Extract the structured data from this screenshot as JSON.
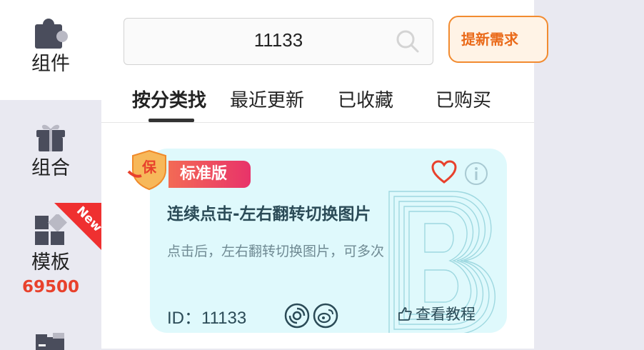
{
  "sidebar": {
    "items": [
      {
        "label": "组件",
        "icon": "puzzle-icon"
      },
      {
        "label": "组合",
        "icon": "gift-icon"
      },
      {
        "label": "模板",
        "icon": "template-icon",
        "count": "69500",
        "ribbon": "New"
      }
    ]
  },
  "search": {
    "value": "11133",
    "icon": "search-icon"
  },
  "header": {
    "demand_button": "提新需求"
  },
  "tabs": [
    {
      "label": "按分类找",
      "active": true
    },
    {
      "label": "最近更新"
    },
    {
      "label": "已收藏"
    },
    {
      "label": "已购买"
    }
  ],
  "card": {
    "badge": "标准版",
    "title": "连续点击-左右翻转切换图片",
    "description": "点击后，左右翻转切换图片，可多次",
    "id_text": "ID：11133",
    "tutorial": "查看教程"
  },
  "colors": {
    "accent": "#e8412c",
    "orange": "#f28b30",
    "card_bg": "#dff9fc"
  }
}
